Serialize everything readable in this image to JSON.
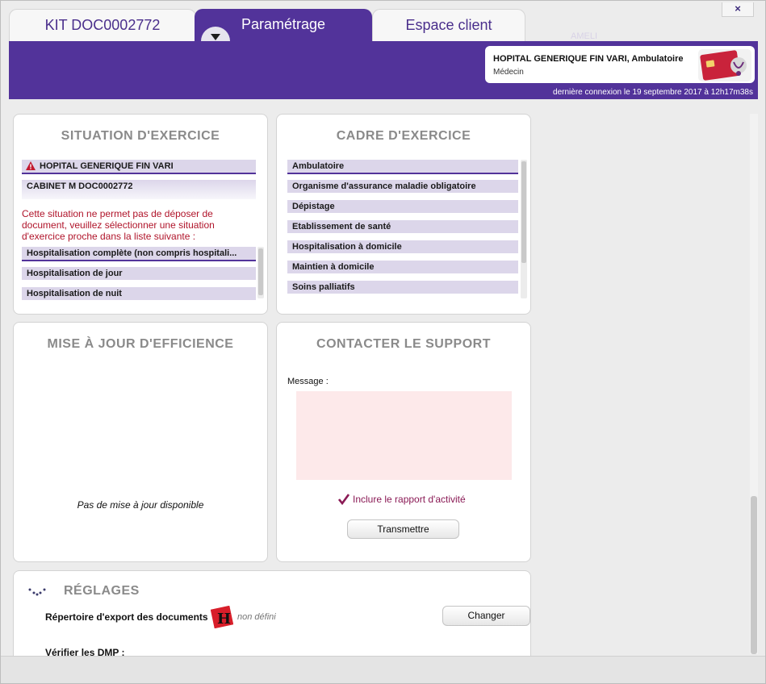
{
  "tabs": {
    "kit": "KIT DOC0002772",
    "param": "Paramétrage",
    "client": "Espace client"
  },
  "header": {
    "ghost_label": "AMELI",
    "user_name": "HOPITAL GENERIQUE  FIN VARI, Ambulatoire",
    "user_role": "Médecin",
    "last_connection": "dernière connexion le 19 septembre 2017 à 12h17m38s",
    "close": "×"
  },
  "situation": {
    "title": "SITUATION D'EXERCICE",
    "selected": "HOPITAL GENERIQUE  FIN VARI",
    "cabinet": "CABINET M DOC0002772",
    "warning": "Cette situation ne permet pas de déposer de document, veuillez sélectionner une situation d'exercice proche dans la liste suivante :",
    "options": [
      "Hospitalisation complète (non compris hospitali...",
      "Hospitalisation de jour",
      "Hospitalisation de nuit"
    ]
  },
  "cadre": {
    "title": "CADRE D'EXERCICE",
    "items": [
      "Ambulatoire",
      "Organisme d'assurance maladie obligatoire",
      "Dépistage",
      "Etablissement de santé",
      "Hospitalisation à domicile",
      "Maintien à domicile",
      "Soins palliatifs"
    ]
  },
  "efficience": {
    "title": "MISE À JOUR D'EFFICIENCE",
    "status": "Pas de mise à jour disponible"
  },
  "support": {
    "title": "CONTACTER LE SUPPORT",
    "message_label": "Message :",
    "message_value": "",
    "include_report": "Inclure le rapport d'activité",
    "include_checked": true,
    "submit": "Transmettre"
  },
  "reglages": {
    "title": "RÉGLAGES",
    "export_label": "Répertoire d'export des documents",
    "export_value": "non défini",
    "change_button": "Changer",
    "verify_label": "Vérifier les DMP :"
  },
  "colors": {
    "brand": "#52339a",
    "warning": "#b0142a",
    "row_bg": "#dcd6ea",
    "message_bg": "#fde9ea",
    "check": "#8a1a55"
  }
}
